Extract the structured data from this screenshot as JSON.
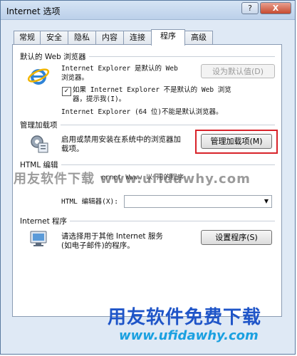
{
  "window": {
    "title": "Internet 选项",
    "help_label": "?",
    "close_label": "X"
  },
  "tabs": [
    {
      "label": "常规"
    },
    {
      "label": "安全"
    },
    {
      "label": "隐私"
    },
    {
      "label": "内容"
    },
    {
      "label": "连接"
    },
    {
      "label": "程序"
    },
    {
      "label": "高级"
    }
  ],
  "default_browser": {
    "heading": "默认的 Web 浏览器",
    "status_line1": "Internet Explorer 是默认的 Web",
    "status_line2": "浏览器。",
    "set_default_button": "设为默认值(D)",
    "check_label_line1": "如果 Internet Explorer 不是默认的 Web 浏览",
    "check_label_line2": "器，提示我(I)。",
    "check_state": "✓",
    "ie64_note": "Internet Explorer (64 位)不能是默认浏览器。"
  },
  "addons": {
    "heading": "管理加载项",
    "desc_line1": "启用或禁用安装在系统中的浏览器加",
    "desc_line2": "载项。",
    "manage_button": "管理加载项(M)"
  },
  "html_editing": {
    "heading": "HTML 编辑",
    "desc": "ernet Wwww 以 用的程序",
    "editor_label": "HTML 编辑器(X):",
    "editor_value": ""
  },
  "internet_programs": {
    "heading": "Internet 程序",
    "desc_line1": "请选择用于其他 Internet 服务",
    "desc_line2": "(如电子邮件)的程序。",
    "set_programs_button": "设置程序(S)"
  },
  "watermark": {
    "mid_text": "用友软件下载 www.ufidawhy.com",
    "brand": "用友软件免费下载",
    "url": "www.ufidawhy.com"
  }
}
